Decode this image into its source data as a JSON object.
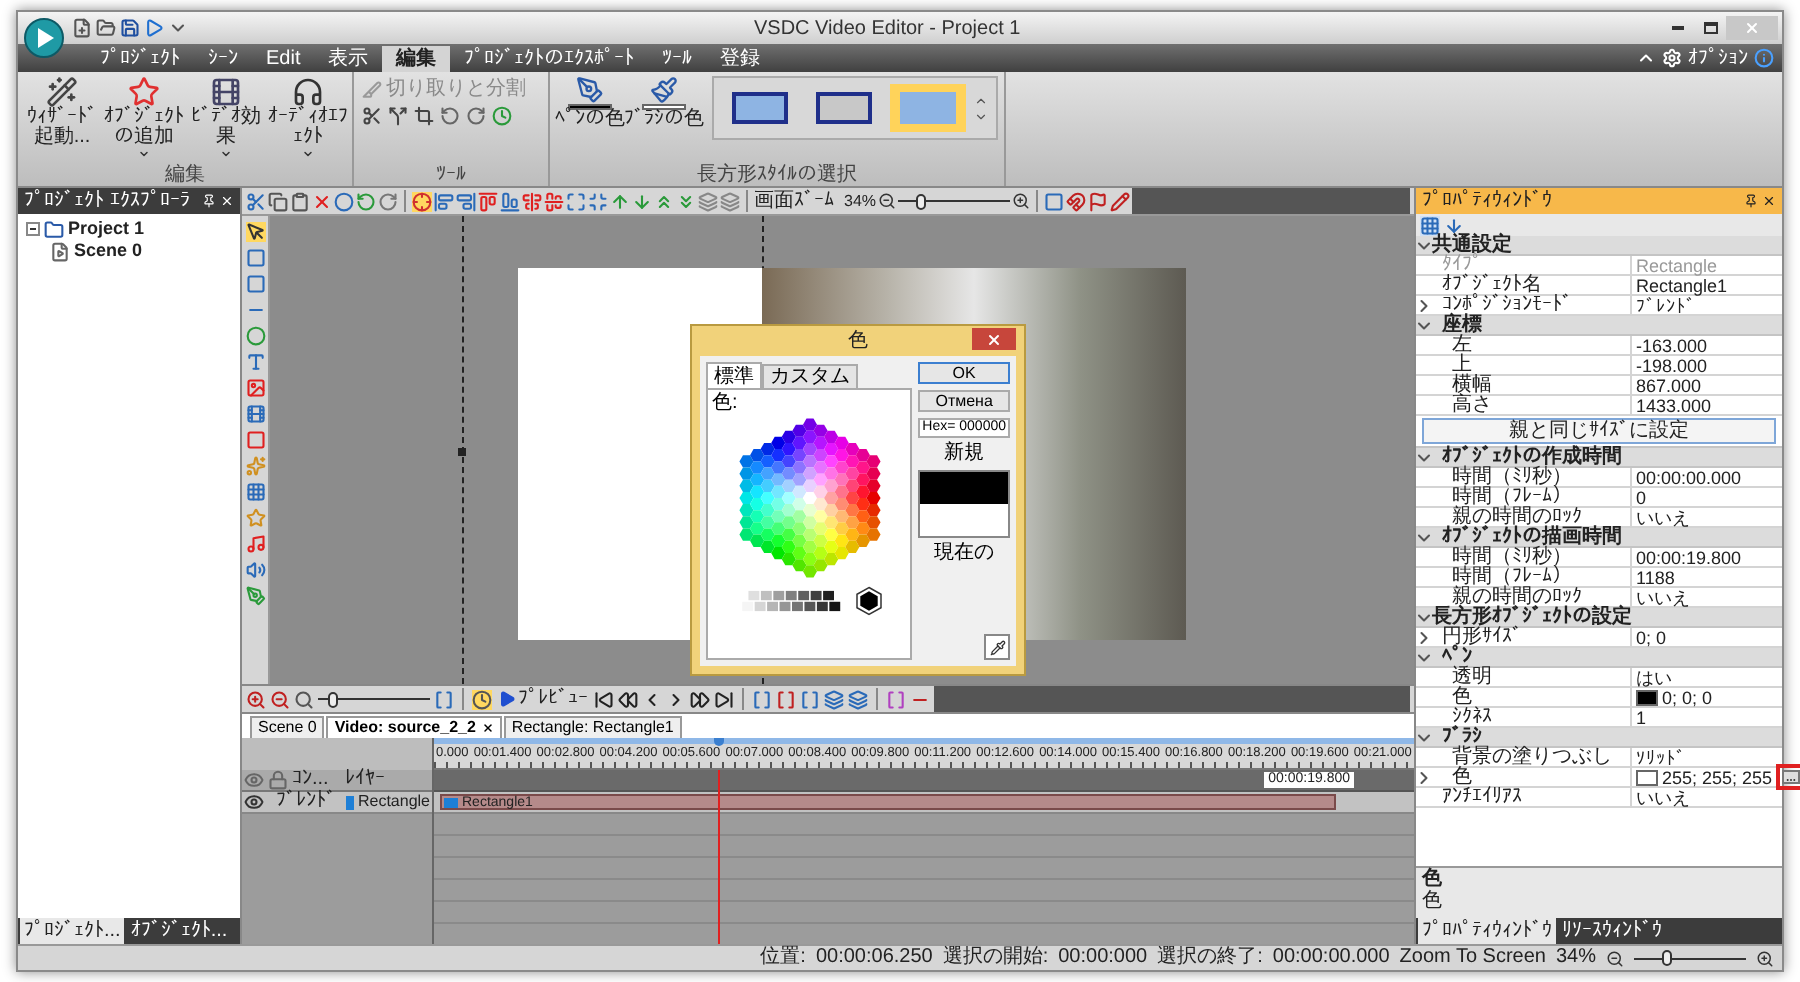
{
  "window": {
    "title": "VSDC Video Editor - Project 1"
  },
  "menu_tabs": [
    {
      "label": "ﾌﾟﾛｼﾞｪｸﾄ",
      "selected": false
    },
    {
      "label": "ｼｰﾝ",
      "selected": false
    },
    {
      "label": "Edit",
      "selected": false
    },
    {
      "label": "表示",
      "selected": false
    },
    {
      "label": "編集",
      "selected": true
    },
    {
      "label": "ﾌﾟﾛｼﾞｪｸﾄのｴｸｽﾎﾟｰﾄ",
      "selected": false
    },
    {
      "label": "ﾂｰﾙ",
      "selected": false
    },
    {
      "label": "登録",
      "selected": false
    }
  ],
  "options_label": "ｵﾌﾟｼｮﾝ",
  "ribbon": {
    "edit_group": {
      "label": "編集",
      "buttons": [
        {
          "label": "ｳｨｻﾞｰﾄﾞ起動...",
          "has_menu": false
        },
        {
          "label": "ｵﾌﾞｼﾞｪｸﾄの追加",
          "has_menu": true
        },
        {
          "label": "ﾋﾞﾃﾞｵ効果",
          "has_menu": true
        },
        {
          "label": "ｵｰﾃﾞｨｵｴﾌｪｸﾄ",
          "has_menu": true
        }
      ]
    },
    "tools_group": {
      "label": "ﾂｰﾙ",
      "cut_split": {
        "label": "切り取りと分割",
        "disabled": true
      }
    },
    "style_group": {
      "label": "長方形ｽﾀｲﾙの選択",
      "pen": {
        "label": "ﾍﾟﾝの色",
        "color": "#000000"
      },
      "brush": {
        "label": "ﾌﾞﾗｼの色",
        "color": "#ffffff"
      },
      "styles": [
        {
          "color": "#8eb4e3",
          "selected": false
        },
        {
          "color": "#c8c8c8",
          "selected": false
        },
        {
          "color": "#8eb4e3",
          "selected": true
        }
      ]
    }
  },
  "project_explorer": {
    "title": "ﾌﾟﾛｼﾞｪｸﾄ ｴｸｽﾌﾟﾛｰﾗ",
    "tree": [
      {
        "label": "Project 1",
        "expanded": true,
        "children": [
          {
            "label": "Scene 0"
          }
        ]
      }
    ],
    "bottom_tabs": [
      {
        "label": "ﾌﾟﾛｼﾞｪｸﾄ...",
        "selected": true
      },
      {
        "label": "ｵﾌﾞｼﾞｪｸﾄ...",
        "selected": false
      }
    ]
  },
  "toolbar": {
    "zoom_label": "画面ｽﾞｰﾑ",
    "zoom_value": "34%",
    "level": 0.22
  },
  "color_dialog": {
    "title": "色",
    "tabs": [
      {
        "label": "標準",
        "selected": true
      },
      {
        "label": "カスタム",
        "selected": false
      }
    ],
    "color_label": "色:",
    "buttons": [
      "OK",
      "Отмена"
    ],
    "hex": "Hex= 000000",
    "swatches": [
      {
        "label": "新規",
        "color": "#000000"
      },
      {
        "label": "現在の",
        "color": "#ffffff"
      }
    ]
  },
  "timeline": {
    "zoom": {
      "level": 0.15
    },
    "preview_label": "ﾌﾟﾚﾋﾞｭｰ",
    "tabs": [
      {
        "label": "Scene 0",
        "selected": false,
        "closable": false
      },
      {
        "label": "Video: source_2_2",
        "selected": true,
        "closable": true
      },
      {
        "label": "Rectangle: Rectangle1",
        "selected": false,
        "closable": false
      }
    ],
    "ruler_ticks": [
      "0.000",
      "00:01.400",
      "00:02.800",
      "00:04.200",
      "00:05.600",
      "00:07.000",
      "00:08.400",
      "00:09.800",
      "00:11.200",
      "00:12.600",
      "00:14.000",
      "00:15.400",
      "00:16.800",
      "00:18.200",
      "00:19.600",
      "00:21.000"
    ],
    "end_marker": "00:00:19.800",
    "playhead": {
      "level": 0.29
    },
    "layer_header": {
      "column_label": "ｺﾝ...",
      "layer_label": "ﾚｲﾔｰ"
    },
    "layers": [
      {
        "blend": "ﾌﾞﾚﾝﾄﾞ",
        "name": "Rectangle",
        "color": "#1e7fd6",
        "clip": "Rectangle1"
      }
    ]
  },
  "properties": {
    "title": "ﾌﾟﾛﾊﾟﾃｨｳｨﾝﾄﾞｳ",
    "items": [
      {
        "kind": "group",
        "label": "共通設定",
        "expanded": true,
        "children": [
          {
            "kind": "field",
            "label": "ﾀｲﾌﾟ",
            "value": "Rectangle",
            "disabled": true
          },
          {
            "kind": "field",
            "label": "ｵﾌﾞｼﾞｪｸﾄ名",
            "value": "Rectangle1"
          },
          {
            "kind": "field",
            "label": "ｺﾝﾎﾟｼﾞｼｮﾝﾓｰﾄﾞ",
            "value": "ﾌﾞﾚﾝﾄﾞ",
            "expanded": false
          },
          {
            "kind": "group",
            "label": "座標",
            "expanded": true,
            "children": [
              {
                "kind": "field",
                "label": "左",
                "value": "-163.000"
              },
              {
                "kind": "field",
                "label": "上",
                "value": "-198.000"
              },
              {
                "kind": "field",
                "label": "横幅",
                "value": "867.000"
              },
              {
                "kind": "field",
                "label": "高さ",
                "value": "1433.000"
              }
            ]
          },
          {
            "kind": "button",
            "label": "親と同じｻｲｽﾞに設定"
          },
          {
            "kind": "group",
            "label": "ｵﾌﾞｼﾞｪｸﾄの作成時間",
            "expanded": true,
            "children": [
              {
                "kind": "field",
                "label": "時間（ﾐﾘ秒）",
                "value": "00:00:00.000"
              },
              {
                "kind": "field",
                "label": "時間（ﾌﾚｰﾑ）",
                "value": "0"
              },
              {
                "kind": "field",
                "label": "親の時間のﾛｯｸ",
                "value": "いいえ"
              }
            ]
          },
          {
            "kind": "group",
            "label": "ｵﾌﾞｼﾞｪｸﾄの描画時間",
            "expanded": true,
            "children": [
              {
                "kind": "field",
                "label": "時間（ﾐﾘ秒）",
                "value": "00:00:19.800"
              },
              {
                "kind": "field",
                "label": "時間（ﾌﾚｰﾑ）",
                "value": "1188"
              },
              {
                "kind": "field",
                "label": "親の時間のﾛｯｸ",
                "value": "いいえ"
              }
            ]
          }
        ]
      },
      {
        "kind": "group",
        "label": "長方形ｵﾌﾞｼﾞｪｸﾄの設定",
        "expanded": true,
        "children": [
          {
            "kind": "field",
            "label": "円形ｻｲｽﾞ",
            "value": "0; 0",
            "expanded": false
          },
          {
            "kind": "group",
            "label": "ﾍﾟﾝ",
            "expanded": true,
            "children": [
              {
                "kind": "field",
                "label": "透明",
                "value": "はい"
              },
              {
                "kind": "color",
                "label": "色",
                "value": "0; 0; 0",
                "color": "#000000",
                "highlighted": false
              },
              {
                "kind": "field",
                "label": "ｼｸﾈｽ",
                "value": "1"
              }
            ]
          },
          {
            "kind": "group",
            "label": "ﾌﾞﾗｼ",
            "expanded": true,
            "children": [
              {
                "kind": "field",
                "label": "背景の塗りつぶし",
                "value": "ｿﾘｯﾄﾞ"
              },
              {
                "kind": "color",
                "label": "色",
                "value": "255; 255; 255",
                "color": "#ffffff",
                "expanded": false,
                "highlighted": true
              }
            ]
          },
          {
            "kind": "field",
            "label": "ｱﾝﾁｴｲﾘｱｽ",
            "value": "いいえ"
          }
        ]
      }
    ],
    "description": {
      "title": "色",
      "text": "色"
    },
    "bottom_tabs": [
      {
        "label": "ﾌﾟﾛﾊﾟﾃｨｳｨﾝﾄﾞｳ",
        "selected": true
      },
      {
        "label": "ﾘｿｰｽｳｨﾝﾄﾞｳ",
        "selected": false
      }
    ]
  },
  "status_bar": {
    "items": [
      "位置:",
      "00:00:06.250",
      "選択の開始:",
      "00:00:000",
      "選択の終了:",
      "00:00:00.000",
      "Zoom To Screen",
      "34%"
    ],
    "level": 0.3
  }
}
